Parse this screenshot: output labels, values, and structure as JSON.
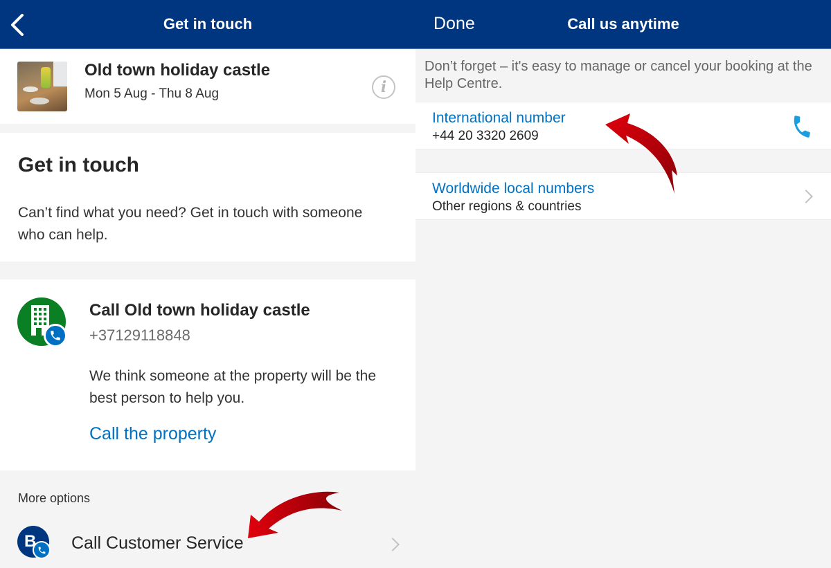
{
  "left_screen": {
    "navbar": {
      "title": "Get in touch",
      "back_icon": "chevron-left-icon"
    },
    "booking": {
      "property_name": "Old town holiday castle",
      "dates": "Mon 5 Aug - Thu 8 Aug",
      "thumbnail_icon": "property-photo",
      "info_icon": "i"
    },
    "get_in_touch": {
      "heading": "Get in touch",
      "description": "Can’t find what you need? Get in touch with someone who can help."
    },
    "call_property": {
      "title": "Call Old town holiday castle",
      "phone": "+37129118848",
      "description": "We think someone at the property will be the best person to help you.",
      "link_label": "Call the property",
      "icon": "building-phone-icon"
    },
    "more_options": {
      "label": "More options",
      "items": [
        {
          "label": "Call Customer Service",
          "icon_letter": "B"
        }
      ]
    }
  },
  "right_screen": {
    "navbar": {
      "done_label": "Done",
      "title": "Call us anytime"
    },
    "notice": "Don’t forget – it's easy to manage or cancel your booking at the Help Centre.",
    "rows": [
      {
        "title": "International number",
        "subtitle": "+44 20 3320 2609",
        "icon": "phone-icon"
      },
      {
        "title": "Worldwide local numbers",
        "subtitle": "Other regions & countries",
        "icon": "chevron-right-icon"
      }
    ]
  },
  "colors": {
    "brand_navy": "#003580",
    "link_blue": "#0071c2",
    "property_green": "#0a7f24",
    "annotation_red": "#c8000a",
    "background_grey": "#f4f4f4"
  }
}
